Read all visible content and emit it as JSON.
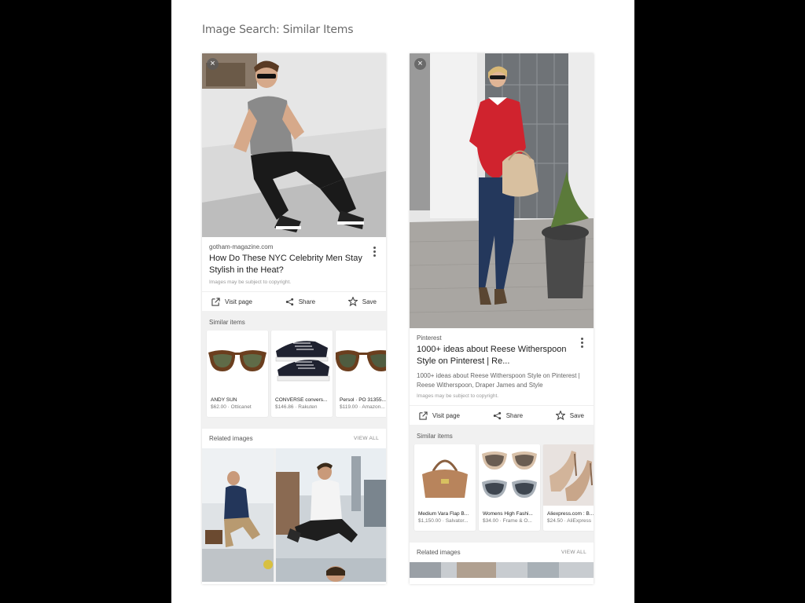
{
  "page": {
    "title": "Image Search: Similar Items"
  },
  "colors": {
    "panel_bg": "#ffffff",
    "section_bg": "#f1f1f1",
    "outer_bg": "#000000"
  },
  "left_card": {
    "close_icon": "close-icon",
    "source": "gotham-magazine.com",
    "headline": "How Do These NYC Celebrity Men Stay Stylish in the Heat?",
    "copyright": "Images may be subject to copyright.",
    "actions": {
      "visit": "Visit page",
      "share": "Share",
      "save": "Save"
    },
    "similar_label": "Similar items",
    "similar_items": [
      {
        "name": "ANDY SUN",
        "price": "$62.00 · Otticanet"
      },
      {
        "name": "CONVERSE convers...",
        "price": "$146.86 · Rakuten"
      },
      {
        "name": "Persol · PO 31355...",
        "price": "$119.00 · Amazon..."
      }
    ],
    "related_label": "Related images",
    "view_all": "VIEW ALL"
  },
  "right_card": {
    "close_icon": "close-icon",
    "source": "Pinterest",
    "headline": "1000+ ideas about Reese Witherspoon Style on Pinterest | Re...",
    "description": "1000+ ideas about Reese Witherspoon Style on Pinterest | Reese Witherspoon, Draper James and Style",
    "copyright": "Images may be subject to copyright.",
    "actions": {
      "visit": "Visit page",
      "share": "Share",
      "save": "Save"
    },
    "similar_label": "Similar items",
    "similar_items": [
      {
        "name": "Medium Vara Flap B...",
        "price": "$1,150.00 · Salvator..."
      },
      {
        "name": "Womens High Fashi...",
        "price": "$34.00 · Frame & O..."
      },
      {
        "name": "Aliexpress.com : B...",
        "price": "$24.50 · AliExpress"
      }
    ],
    "related_label": "Related images",
    "view_all": "VIEW ALL"
  }
}
